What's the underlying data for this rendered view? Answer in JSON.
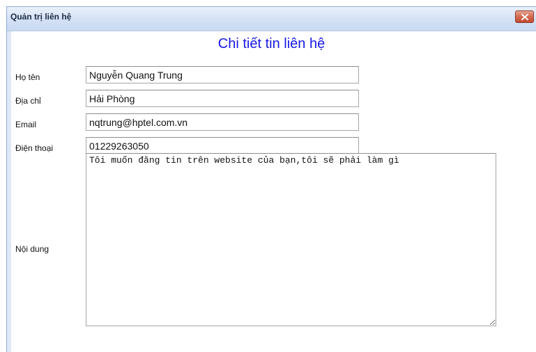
{
  "window": {
    "title": "Quản trị liên hệ",
    "close_icon": "close-icon"
  },
  "form": {
    "heading": "Chi tiết tin liên hệ",
    "name_label": "Họ tên",
    "name_value": "Nguyễn Quang Trung",
    "address_label": "Địa chỉ",
    "address_value": "Hải Phòng",
    "email_label": "Email",
    "email_value": "nqtrung@hptel.com.vn",
    "phone_label": "Điện thoại",
    "phone_value": "01229263050",
    "content_label": "Nội dung",
    "content_value": "Tôi muốn đăng tin trên website của bạn,tôi sẽ phải làm gì"
  },
  "colors": {
    "heading": "#1717e6",
    "titlebar": "#d4e1f5",
    "close_button": "#d46a4f"
  }
}
